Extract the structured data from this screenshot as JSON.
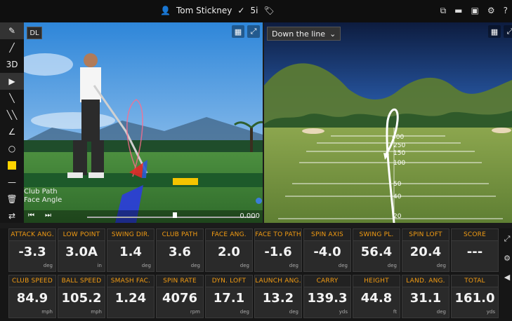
{
  "header": {
    "user_name": "Tom Stickney",
    "club": "5i"
  },
  "toolbar": {
    "tools": [
      "pen-icon",
      "line-icon",
      "3d",
      "cursor-icon",
      "line-icon-2",
      "double-line-icon",
      "angle-icon",
      "circle-icon",
      "color-swatch",
      "minus-icon",
      "trash-icon",
      "share-icon"
    ]
  },
  "left_view": {
    "mode_badge": "DL",
    "label_club_path": "Club Path",
    "label_face_angle": "Face Angle",
    "time_readout": "0.000"
  },
  "right_view": {
    "view_selected": "Down the line",
    "distance_labels": [
      "400",
      "250",
      "150",
      "100",
      "50",
      "40",
      "20"
    ]
  },
  "metrics": {
    "row1": [
      {
        "label": "ATTACK ANG.",
        "value": "-3.3",
        "unit": "deg"
      },
      {
        "label": "LOW POINT",
        "value": "3.0A",
        "unit": "in"
      },
      {
        "label": "SWING DIR.",
        "value": "1.4",
        "unit": "deg"
      },
      {
        "label": "CLUB PATH",
        "value": "3.6",
        "unit": "deg"
      },
      {
        "label": "FACE ANG.",
        "value": "2.0",
        "unit": "deg"
      },
      {
        "label": "FACE TO PATH",
        "value": "-1.6",
        "unit": "deg"
      },
      {
        "label": "SPIN AXIS",
        "value": "-4.0",
        "unit": "deg"
      },
      {
        "label": "SWING PL.",
        "value": "56.4",
        "unit": "deg"
      },
      {
        "label": "SPIN LOFT",
        "value": "20.4",
        "unit": "deg"
      },
      {
        "label": "SCORE",
        "value": "---",
        "unit": ""
      }
    ],
    "row2": [
      {
        "label": "CLUB SPEED",
        "value": "84.9",
        "unit": "mph"
      },
      {
        "label": "BALL SPEED",
        "value": "105.2",
        "unit": "mph"
      },
      {
        "label": "SMASH FAC.",
        "value": "1.24",
        "unit": ""
      },
      {
        "label": "SPIN RATE",
        "value": "4076",
        "unit": "rpm"
      },
      {
        "label": "DYN. LOFT",
        "value": "17.1",
        "unit": "deg"
      },
      {
        "label": "LAUNCH ANG.",
        "value": "13.2",
        "unit": "deg"
      },
      {
        "label": "CARRY",
        "value": "139.3",
        "unit": "yds"
      },
      {
        "label": "HEIGHT",
        "value": "44.8",
        "unit": "ft"
      },
      {
        "label": "LAND. ANG.",
        "value": "31.1",
        "unit": "deg"
      },
      {
        "label": "TOTAL",
        "value": "161.0",
        "unit": "yds"
      }
    ]
  },
  "colors": {
    "label_orange": "#f39c12",
    "card_bg": "#2a2a2a",
    "panel_bg": "#161616"
  }
}
